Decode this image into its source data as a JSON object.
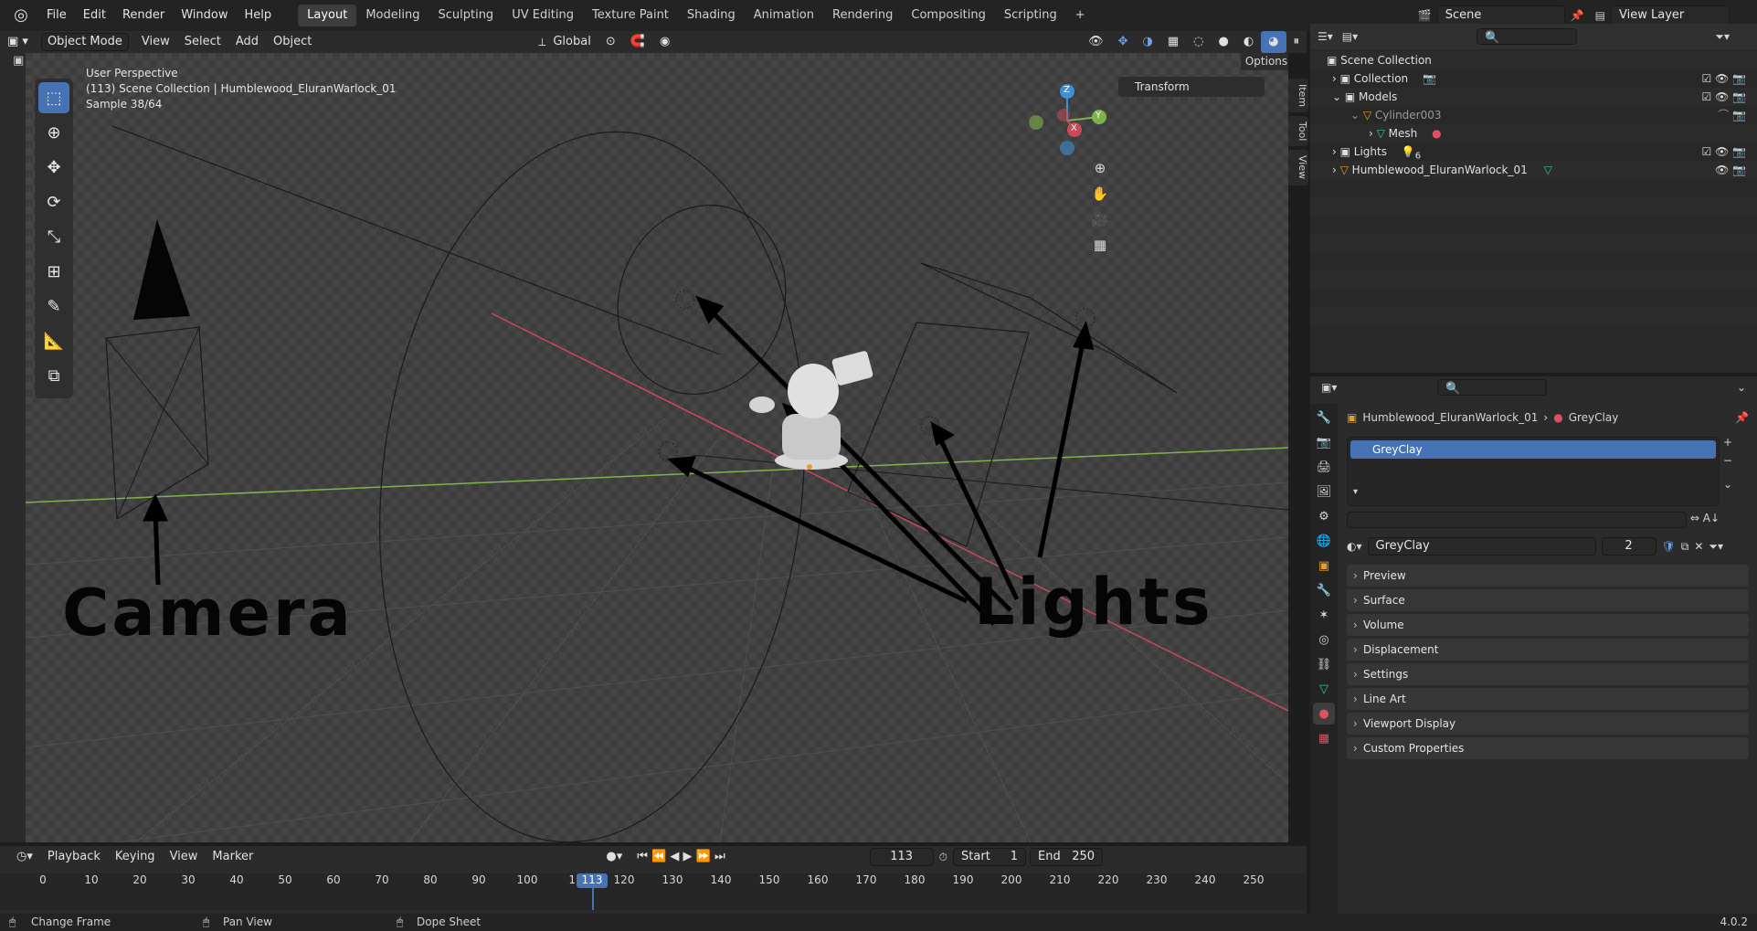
{
  "topbar": {
    "menus": [
      "File",
      "Edit",
      "Render",
      "Window",
      "Help"
    ],
    "workspaces": [
      "Layout",
      "Modeling",
      "Sculpting",
      "UV Editing",
      "Texture Paint",
      "Shading",
      "Animation",
      "Rendering",
      "Compositing",
      "Scripting"
    ],
    "active_workspace": "Layout",
    "add_workspace": "+",
    "scene": "Scene",
    "view_layer": "View Layer"
  },
  "viewport_header": {
    "mode": "Object Mode",
    "menus": [
      "View",
      "Select",
      "Add",
      "Object"
    ],
    "orientation": "Global",
    "options": "Options"
  },
  "viewport": {
    "perspective": "User Perspective",
    "collection": "(113) Scene Collection | Humblewood_EluranWarlock_01",
    "sample": "Sample 38/64",
    "camera_label": "Camera",
    "lights_label": "Lights",
    "transform_panel": "Transform",
    "side_tabs": [
      "Item",
      "Tool",
      "View"
    ],
    "gizmo_axes": [
      "Z",
      "X",
      "Y"
    ]
  },
  "outliner": {
    "root": "Scene Collection",
    "items": [
      {
        "label": "Collection",
        "depth": 1
      },
      {
        "label": "Models",
        "depth": 1
      },
      {
        "label": "Cylinder003",
        "depth": 2
      },
      {
        "label": "Mesh",
        "depth": 3
      },
      {
        "label": "Lights",
        "depth": 1,
        "badge": "6"
      },
      {
        "label": "Humblewood_EluranWarlock_01",
        "depth": 1
      }
    ]
  },
  "properties": {
    "object": "Humblewood_EluranWarlock_01",
    "material": "GreyClay",
    "slot": "GreyClay",
    "material_field": "GreyClay",
    "users": "2",
    "panels": [
      "Preview",
      "Surface",
      "Volume",
      "Displacement",
      "Settings",
      "Line Art",
      "Viewport Display",
      "Custom Properties"
    ]
  },
  "timeline": {
    "menus": [
      "Playback",
      "Keying",
      "View",
      "Marker"
    ],
    "current_frame": "113",
    "start_label": "Start",
    "start": "1",
    "end_label": "End",
    "end": "250",
    "ticks": [
      "0",
      "10",
      "20",
      "30",
      "40",
      "50",
      "60",
      "70",
      "80",
      "90",
      "100",
      "11",
      "120",
      "130",
      "140",
      "150",
      "160",
      "170",
      "180",
      "190",
      "200",
      "210",
      "220",
      "230",
      "240",
      "250"
    ]
  },
  "statusbar": {
    "items": [
      "Change Frame",
      "Pan View",
      "Dope Sheet"
    ],
    "version": "4.0.2"
  },
  "colors": {
    "accent": "#4772b3",
    "axis_x": "#c94a5a",
    "axis_y": "#7fb24a",
    "axis_z": "#3d8fd6"
  }
}
